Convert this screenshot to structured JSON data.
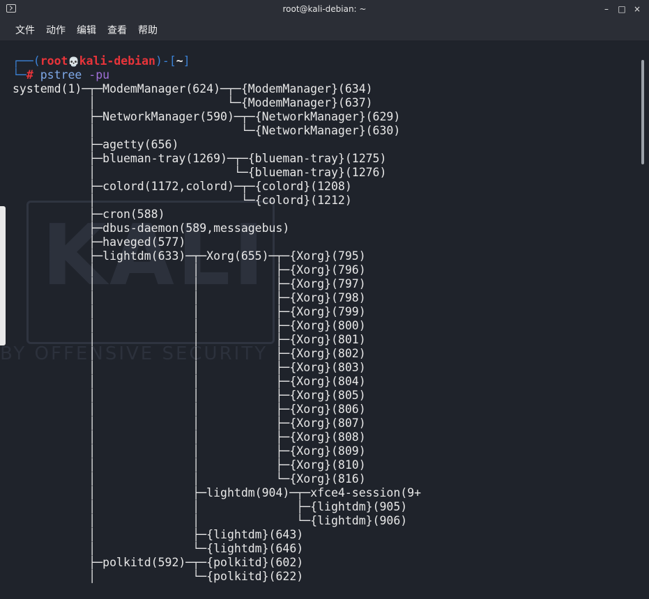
{
  "window": {
    "title": "root@kali-debian: ~",
    "minimize": "–",
    "maximize": "□",
    "close": "×"
  },
  "menu": [
    "文件",
    "动作",
    "编辑",
    "查看",
    "帮助"
  ],
  "watermark": {
    "text": "KALI",
    "subtext": "BY OFFENSIVE SECURITY"
  },
  "prompt": {
    "user": "root",
    "skull": "💀",
    "host": "kali-debian",
    "dir": "~",
    "symbol": "#",
    "command": "pstree",
    "args": "-pu"
  },
  "output_lines": [
    "systemd(1)─┬─ModemManager(624)─┬─{ModemManager}(634)",
    "           │                   └─{ModemManager}(637)",
    "           ├─NetworkManager(590)─┬─{NetworkManager}(629)",
    "           │                     └─{NetworkManager}(630)",
    "           ├─agetty(656)",
    "           ├─blueman-tray(1269)─┬─{blueman-tray}(1275)",
    "           │                    └─{blueman-tray}(1276)",
    "           ├─colord(1172,colord)─┬─{colord}(1208)",
    "           │                     └─{colord}(1212)",
    "           ├─cron(588)",
    "           ├─dbus-daemon(589,messagebus)",
    "           ├─haveged(577)",
    "           ├─lightdm(633)─┬─Xorg(655)─┬─{Xorg}(795)",
    "           │              │           ├─{Xorg}(796)",
    "           │              │           ├─{Xorg}(797)",
    "           │              │           ├─{Xorg}(798)",
    "           │              │           ├─{Xorg}(799)",
    "           │              │           ├─{Xorg}(800)",
    "           │              │           ├─{Xorg}(801)",
    "           │              │           ├─{Xorg}(802)",
    "           │              │           ├─{Xorg}(803)",
    "           │              │           ├─{Xorg}(804)",
    "           │              │           ├─{Xorg}(805)",
    "           │              │           ├─{Xorg}(806)",
    "           │              │           ├─{Xorg}(807)",
    "           │              │           ├─{Xorg}(808)",
    "           │              │           ├─{Xorg}(809)",
    "           │              │           ├─{Xorg}(810)",
    "           │              │           └─{Xorg}(816)",
    "           │              ├─lightdm(904)─┬─xfce4-session(9+",
    "           │              │              ├─{lightdm}(905)",
    "           │              │              └─{lightdm}(906)",
    "           │              ├─{lightdm}(643)",
    "           │              └─{lightdm}(646)",
    "           ├─polkitd(592)─┬─{polkitd}(602)",
    "           │              └─{polkitd}(622)"
  ]
}
